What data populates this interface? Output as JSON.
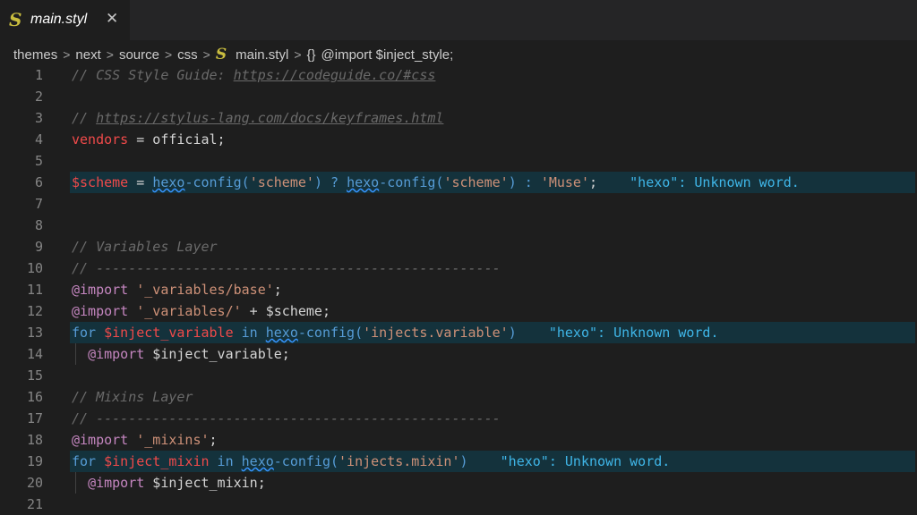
{
  "tab": {
    "filename": "main.styl",
    "icon": "stylus-file-icon",
    "close": "✕"
  },
  "breadcrumb": {
    "items": [
      "themes",
      "next",
      "source",
      "css"
    ],
    "file": "main.styl",
    "symbol_icon": "{}",
    "symbol": "@import $inject_style;"
  },
  "lines": [
    {
      "n": "1",
      "hl": false,
      "tokens": [
        {
          "t": "// CSS Style Guide: ",
          "c": "cm"
        },
        {
          "t": "https://codeguide.co/#css",
          "c": "cm-link"
        }
      ]
    },
    {
      "n": "2",
      "hl": false,
      "tokens": []
    },
    {
      "n": "3",
      "hl": false,
      "tokens": [
        {
          "t": "// ",
          "c": "cm"
        },
        {
          "t": "https://stylus-lang.com/docs/keyframes.html",
          "c": "cm-link"
        }
      ]
    },
    {
      "n": "4",
      "hl": false,
      "tokens": [
        {
          "t": "vendors",
          "c": "var"
        },
        {
          "t": " = official;",
          "c": "op"
        }
      ]
    },
    {
      "n": "5",
      "hl": false,
      "tokens": []
    },
    {
      "n": "6",
      "hl": true,
      "tokens": [
        {
          "t": "$scheme",
          "c": "var"
        },
        {
          "t": " = ",
          "c": "op"
        },
        {
          "t": "hexo",
          "c": "fn-sq"
        },
        {
          "t": "-config(",
          "c": "fn"
        },
        {
          "t": "'scheme'",
          "c": "str"
        },
        {
          "t": ") ? ",
          "c": "fn"
        },
        {
          "t": "hexo",
          "c": "fn-sq"
        },
        {
          "t": "-config(",
          "c": "fn"
        },
        {
          "t": "'scheme'",
          "c": "str"
        },
        {
          "t": ") : ",
          "c": "fn"
        },
        {
          "t": "'Muse'",
          "c": "str"
        },
        {
          "t": ";",
          "c": "op"
        },
        {
          "t": "    \"hexo\": Unknown word.",
          "c": "diag"
        }
      ]
    },
    {
      "n": "7",
      "hl": false,
      "tokens": []
    },
    {
      "n": "8",
      "hl": false,
      "tokens": []
    },
    {
      "n": "9",
      "hl": false,
      "tokens": [
        {
          "t": "// Variables Layer",
          "c": "cm"
        }
      ]
    },
    {
      "n": "10",
      "hl": false,
      "tokens": [
        {
          "t": "// --------------------------------------------------",
          "c": "cm"
        }
      ]
    },
    {
      "n": "11",
      "hl": false,
      "tokens": [
        {
          "t": "@import",
          "c": "kw"
        },
        {
          "t": " ",
          "c": "op"
        },
        {
          "t": "'_variables/base'",
          "c": "str"
        },
        {
          "t": ";",
          "c": "op"
        }
      ]
    },
    {
      "n": "12",
      "hl": false,
      "tokens": [
        {
          "t": "@import",
          "c": "kw"
        },
        {
          "t": " ",
          "c": "op"
        },
        {
          "t": "'_variables/'",
          "c": "str"
        },
        {
          "t": " + $scheme;",
          "c": "op"
        }
      ]
    },
    {
      "n": "13",
      "hl": true,
      "tokens": [
        {
          "t": "for",
          "c": "kwblue"
        },
        {
          "t": " ",
          "c": "op"
        },
        {
          "t": "$inject_variable",
          "c": "var"
        },
        {
          "t": " in ",
          "c": "kwblue"
        },
        {
          "t": "hexo",
          "c": "fn-sq"
        },
        {
          "t": "-config(",
          "c": "fn"
        },
        {
          "t": "'injects.variable'",
          "c": "str"
        },
        {
          "t": ")",
          "c": "fn"
        },
        {
          "t": "    \"hexo\": Unknown word.",
          "c": "diag"
        }
      ]
    },
    {
      "n": "14",
      "hl": false,
      "indent": true,
      "tokens": [
        {
          "t": "  ",
          "c": "op"
        },
        {
          "t": "@import",
          "c": "kw"
        },
        {
          "t": " $inject_variable;",
          "c": "op"
        }
      ]
    },
    {
      "n": "15",
      "hl": false,
      "tokens": []
    },
    {
      "n": "16",
      "hl": false,
      "tokens": [
        {
          "t": "// Mixins Layer",
          "c": "cm"
        }
      ]
    },
    {
      "n": "17",
      "hl": false,
      "tokens": [
        {
          "t": "// --------------------------------------------------",
          "c": "cm"
        }
      ]
    },
    {
      "n": "18",
      "hl": false,
      "tokens": [
        {
          "t": "@import",
          "c": "kw"
        },
        {
          "t": " ",
          "c": "op"
        },
        {
          "t": "'_mixins'",
          "c": "str"
        },
        {
          "t": ";",
          "c": "op"
        }
      ]
    },
    {
      "n": "19",
      "hl": true,
      "tokens": [
        {
          "t": "for",
          "c": "kwblue"
        },
        {
          "t": " ",
          "c": "op"
        },
        {
          "t": "$inject_mixin",
          "c": "var"
        },
        {
          "t": " in ",
          "c": "kwblue"
        },
        {
          "t": "hexo",
          "c": "fn-sq"
        },
        {
          "t": "-config(",
          "c": "fn"
        },
        {
          "t": "'injects.mixin'",
          "c": "str"
        },
        {
          "t": ")",
          "c": "fn"
        },
        {
          "t": "    \"hexo\": Unknown word.",
          "c": "diag"
        }
      ]
    },
    {
      "n": "20",
      "hl": false,
      "indent": true,
      "tokens": [
        {
          "t": "  ",
          "c": "op"
        },
        {
          "t": "@import",
          "c": "kw"
        },
        {
          "t": " $inject_mixin;",
          "c": "op"
        }
      ]
    },
    {
      "n": "21",
      "hl": false,
      "tokens": []
    }
  ]
}
